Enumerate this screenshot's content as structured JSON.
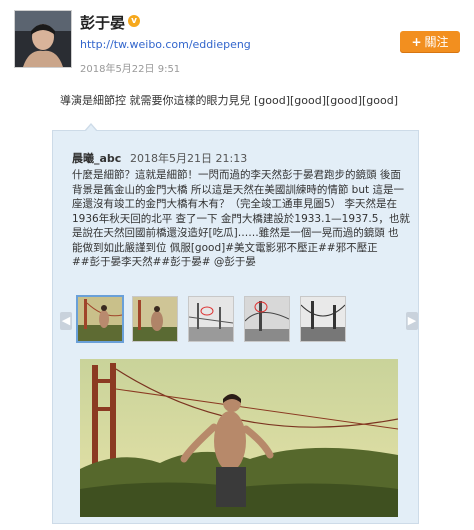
{
  "profile": {
    "name": "彭于晏",
    "verified_badge": "v",
    "url": "http://tw.weibo.com/eddiepeng",
    "timestamp": "2018年5月22日  9:51"
  },
  "follow_button": {
    "plus": "+",
    "label": "關注"
  },
  "post": {
    "text": "導演是細節控 就需要你這樣的眼力見兒 [good][good][good][good]"
  },
  "repost": {
    "author": "晨曦_abc",
    "time": "2018年5月21日 21:13",
    "lines": [
      "什麼是細節？這就是細節！一閃而過的李天然彭于晏君跑步的鏡頭 後面",
      "背景是舊金山的金門大橋 所以這是天然在美國訓練時的情節 but 這是一",
      "座還沒有竣工的金門大橋有木有？（完全竣工通車見圖5） 李天然是在",
      "1936年秋天回的北平 查了一下 金門大橋建設於1933.1—1937.5，也就",
      "是說在天然回國前橋還沒造好[吃瓜]……雖然是一個一晃而過的鏡頭 也",
      "能做到如此嚴謹到位 佩服[good]#美文電影邪不壓正##邪不壓正",
      "##彭于晏李天然##彭于晏# @彭于晏"
    ]
  },
  "gallery": {
    "prev_icon": "◀",
    "next_icon": "▶",
    "thumbnails": [
      "thumb-1",
      "thumb-2",
      "thumb-3",
      "thumb-4",
      "thumb-5"
    ]
  },
  "colors": {
    "accent_orange": "#f28f1f",
    "link_blue": "#3366cc",
    "repost_bg": "#e3eef7"
  }
}
